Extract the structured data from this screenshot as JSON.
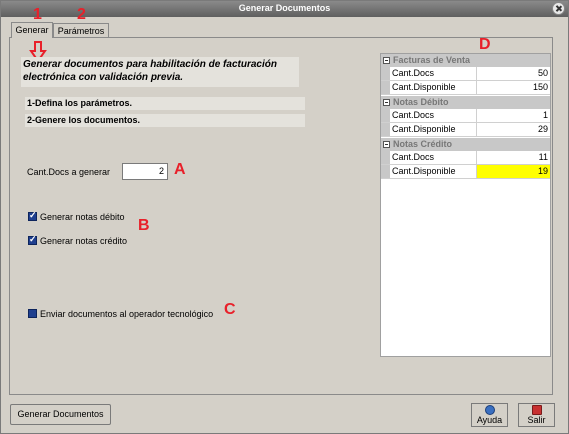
{
  "window": {
    "title": "Generar Documentos"
  },
  "tabs": [
    {
      "label": "Generar",
      "active": true
    },
    {
      "label": "Parámetros",
      "active": false
    }
  ],
  "annotations": {
    "n1": "1",
    "n2": "2",
    "a": "A",
    "b": "B",
    "c": "C",
    "d": "D"
  },
  "form": {
    "heading": "Generar documentos para habilitación de facturación electrónica con validación previa.",
    "step1": "1-Defina los parámetros.",
    "step2": "2-Genere los documentos.",
    "cant_docs_label": "Cant.Docs a generar",
    "cant_docs_value": "2",
    "chk_debito_label": "Generar notas débito",
    "chk_debito_checked": true,
    "chk_credito_label": "Generar notas crédito",
    "chk_credito_checked": true,
    "chk_enviar_label": "Enviar documentos al operador tecnológico",
    "chk_enviar_checked": false
  },
  "grid": {
    "groups": [
      {
        "title": "Facturas de Venta",
        "rows": [
          {
            "key": "Cant.Docs",
            "value": "50"
          },
          {
            "key": "Cant.Disponible",
            "value": "150"
          }
        ]
      },
      {
        "title": "Notas Débito",
        "rows": [
          {
            "key": "Cant.Docs",
            "value": "1"
          },
          {
            "key": "Cant.Disponible",
            "value": "29"
          }
        ]
      },
      {
        "title": "Notas Crédito",
        "rows": [
          {
            "key": "Cant.Docs",
            "value": "11"
          },
          {
            "key": "Cant.Disponible",
            "value": "19",
            "highlight": "#ffff00"
          }
        ]
      }
    ]
  },
  "buttons": {
    "generar": "Generar Documentos",
    "ayuda": "Ayuda",
    "salir": "Salir",
    "ayuda_icon": "help-icon",
    "salir_icon": "exit-icon"
  },
  "colors": {
    "annotation": "#e8202a",
    "highlight": "#ffff00",
    "titlebar": "#6e6e6e"
  }
}
